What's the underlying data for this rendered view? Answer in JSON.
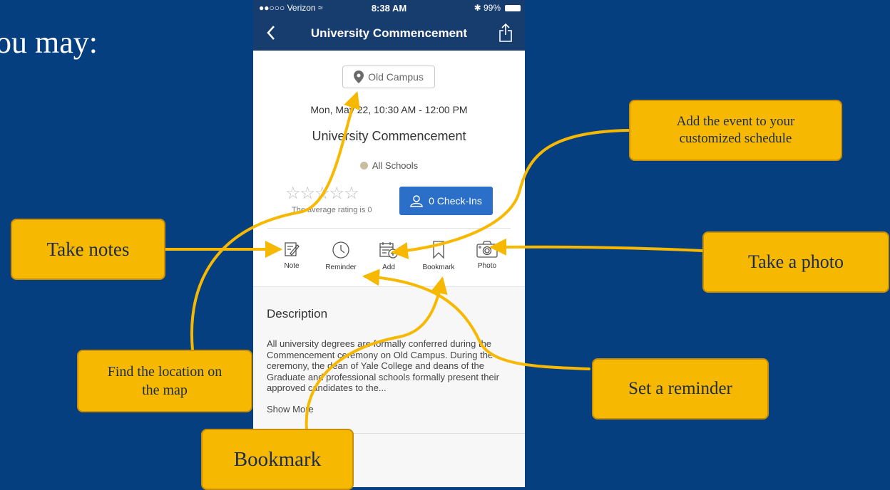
{
  "slide": {
    "title": "ou may:"
  },
  "status_bar": {
    "carrier": "●●○○○ Verizon ≈",
    "time": "8:38 AM",
    "battery": "✱ 99%"
  },
  "nav": {
    "title": "University Commencement"
  },
  "event": {
    "location": "Old Campus",
    "date": "Mon, May 22, 10:30 AM - 12:00 PM",
    "title": "University Commencement",
    "school": "All Schools",
    "stars": "☆☆☆☆☆",
    "rating_text": "The average rating is 0",
    "checkins_label": "0 Check-Ins"
  },
  "actions": {
    "note": "Note",
    "reminder": "Reminder",
    "add": "Add",
    "bookmark": "Bookmark",
    "photo": "Photo"
  },
  "description": {
    "heading": "Description",
    "body": "All university degrees are formally conferred during the Commencement ceremony on Old Campus. During the ceremony, the dean of Yale College and deans of the Graduate and professional schools formally present their approved candidates to the...",
    "show_more": "Show More"
  },
  "callouts": {
    "take_notes": "Take notes",
    "add_event": "Add the event to your customized schedule",
    "take_photo": "Take a photo",
    "find_location": "Find the location on the map",
    "set_reminder": "Set a reminder",
    "bookmark": "Bookmark"
  },
  "colors": {
    "background": "#053f7f",
    "nav_bar": "#173d6e",
    "callout": "#f6b800",
    "checkin_button": "#2b6fc8"
  }
}
